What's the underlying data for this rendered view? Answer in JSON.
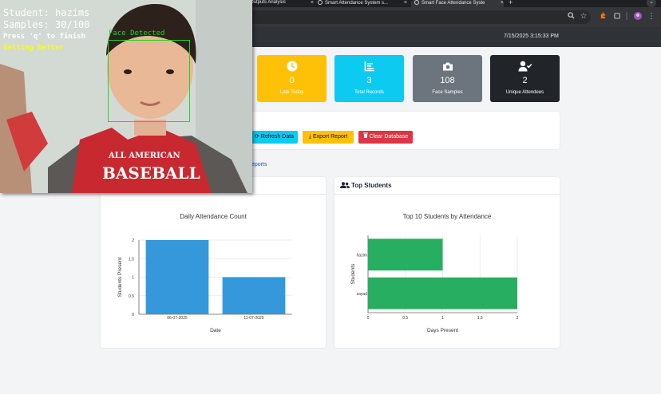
{
  "browser": {
    "tabs": [
      {
        "label": "Outputs Analysis"
      },
      {
        "label": "Smart Attendance System s..."
      },
      {
        "label": "Smart Face Attendance Syste",
        "active": true
      }
    ]
  },
  "navbar": {
    "datetime": "7/15/2025 3:15:33 PM"
  },
  "stats": [
    {
      "icon": "clock-icon",
      "value": "0",
      "label": "Late Today",
      "color": "#ffc107"
    },
    {
      "icon": "list-icon",
      "value": "3",
      "label": "Total Records",
      "color": "#0dcaf0"
    },
    {
      "icon": "camera-icon",
      "value": "108",
      "label": "Face Samples",
      "color": "#6c757d"
    },
    {
      "icon": "user-check-icon",
      "value": "2",
      "label": "Unique Attendees",
      "color": "#212529"
    }
  ],
  "actions": {
    "refresh": "Refresh Data",
    "export": "Export Report",
    "clear": "Clear Database",
    "reports_link": "eports"
  },
  "panels": {
    "top_students_title": "Top Students"
  },
  "camera": {
    "student": "Student: hazims",
    "samples": "Samples: 30/100",
    "finish_hint": "Press 'q' to finish",
    "status": "Getting better",
    "face_label": "Face Detected",
    "shirt_line1": "ALL AMERICAN",
    "shirt_line2": "BASEBALL"
  },
  "chart_data": [
    {
      "type": "bar",
      "title": "Daily Attendance Count",
      "xlabel": "Date",
      "ylabel": "Students Present",
      "categories": [
        "06-07-2025",
        "11-07-2025"
      ],
      "values": [
        2,
        1
      ],
      "ylim": [
        0,
        2
      ],
      "yticks": [
        "0",
        "0.5",
        "1",
        "1.5",
        "2"
      ],
      "color": "#3498db",
      "grid": true
    },
    {
      "type": "bar",
      "orientation": "horizontal",
      "title": "Top 10 Students by Attendance",
      "xlabel": "Days Present",
      "ylabel": "Students",
      "categories": [
        "hazim",
        "sayad"
      ],
      "values": [
        1,
        2
      ],
      "xlim": [
        0,
        2
      ],
      "xticks": [
        "0",
        "0.5",
        "1",
        "1.5",
        "2"
      ],
      "color": "#27ae60",
      "grid": true
    }
  ]
}
